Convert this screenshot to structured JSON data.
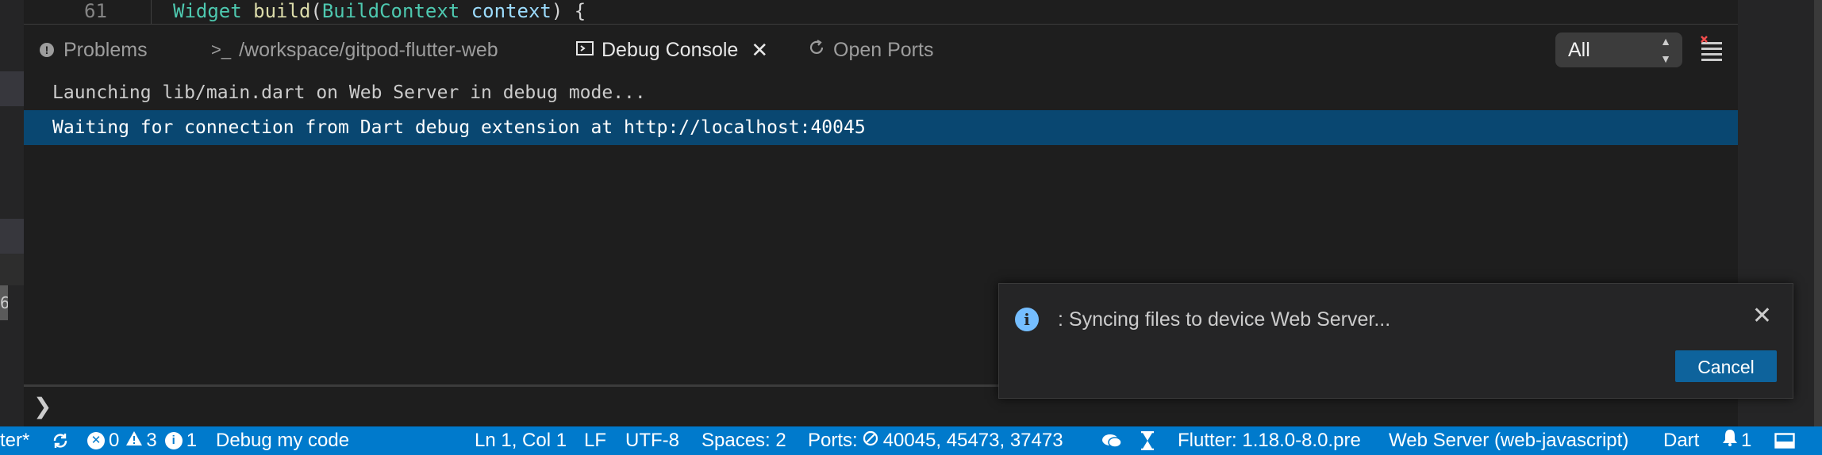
{
  "editor": {
    "line_number": "61",
    "code": {
      "type": "Widget",
      "fn": "build",
      "paren_open": "(",
      "param_type": "BuildContext",
      "param": "context",
      "tail": ") {"
    }
  },
  "left_strip": {
    "partial_digit": "6"
  },
  "panel": {
    "tabs": [
      {
        "label": "Problems",
        "icon": "info-circle-icon"
      },
      {
        "label": "/workspace/gitpod-flutter-web",
        "icon": "terminal-icon",
        "prefix": ">_"
      },
      {
        "label": "Debug Console",
        "icon": "debug-console-icon",
        "active": true
      },
      {
        "label": "Open Ports",
        "icon": "refresh-icon"
      }
    ],
    "filter": {
      "selected": "All"
    },
    "output_lines": [
      "Launching lib/main.dart on Web Server in debug mode...",
      "Waiting for connection from Dart debug extension at http://localhost:40045"
    ],
    "prompt_glyph": "❯"
  },
  "notification": {
    "message": ": Syncing files to device Web Server...",
    "button": "Cancel"
  },
  "status_bar": {
    "branch_fragment": "ter*",
    "errors": "0",
    "warnings": "3",
    "infos": "1",
    "debug_target": "Debug my code",
    "position": "Ln 1, Col 1",
    "eol": "LF",
    "encoding": "UTF-8",
    "spaces": "Spaces: 2",
    "ports_label": "Ports:",
    "ports": "40045, 45473, 37473",
    "flutter": "Flutter: 1.18.0-8.0.pre",
    "device": "Web Server (web-javascript)",
    "language": "Dart",
    "notifications": "1"
  },
  "colors": {
    "status_bar": "#007acc",
    "selected_line": "#094771",
    "button": "#0e639c",
    "info": "#75beff"
  }
}
